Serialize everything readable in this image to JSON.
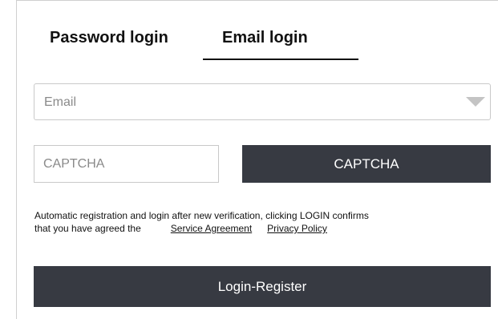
{
  "tabs": [
    {
      "label": "Password login",
      "active": false
    },
    {
      "label": "Email login",
      "active": true
    }
  ],
  "email_select": {
    "placeholder": "Email",
    "icon": "caret-down-icon"
  },
  "captcha": {
    "input_placeholder": "CAPTCHA",
    "button_label": "CAPTCHA"
  },
  "notice": {
    "line1": "Automatic registration and login after new verification, clicking LOGIN confirms",
    "line2_prefix": "that you have agreed the",
    "service_agreement": "Service Agreement",
    "privacy_policy": "Privacy Policy"
  },
  "login_button": {
    "label": "Login-Register"
  },
  "colors": {
    "button_bg": "#373a42",
    "button_text": "#ffffff",
    "border": "#c9c9c9",
    "placeholder": "#8a8a8a"
  }
}
